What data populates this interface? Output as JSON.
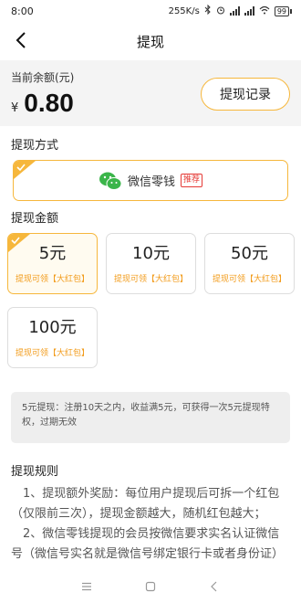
{
  "status_bar": {
    "time": "8:00",
    "network_speed": "255K/s",
    "battery": "99"
  },
  "header": {
    "title": "提现"
  },
  "balance": {
    "label": "当前余额(元)",
    "currency": "¥",
    "amount": "0.80",
    "record_button": "提现记录"
  },
  "method": {
    "section_label": "提现方式",
    "name": "微信零钱",
    "badge": "推荐"
  },
  "amounts": {
    "section_label": "提现金额",
    "options": [
      {
        "value": "5元",
        "note": "提现可领【大红包】",
        "selected": true
      },
      {
        "value": "10元",
        "note": "提现可领【大红包】",
        "selected": false
      },
      {
        "value": "50元",
        "note": "提现可领【大红包】",
        "selected": false
      },
      {
        "value": "100元",
        "note": "提现可领【大红包】",
        "selected": false
      }
    ]
  },
  "notice": "5元提现：注册10天之内，收益满5元，可获得一次5元提现特权，过期无效",
  "rules": {
    "title": "提现规则",
    "items": [
      "1、提现额外奖励：每位用户提现后可拆一个红包（仅限前三次），提现金额越大，随机红包越大；",
      "2、微信零钱提现的会员按微信要求实名认证微信号（微信号实名就是微信号绑定银行卡或者身份证）"
    ]
  },
  "colors": {
    "accent": "#f6b73c",
    "accent_text": "#f29b1a",
    "badge_red": "#e53935"
  }
}
